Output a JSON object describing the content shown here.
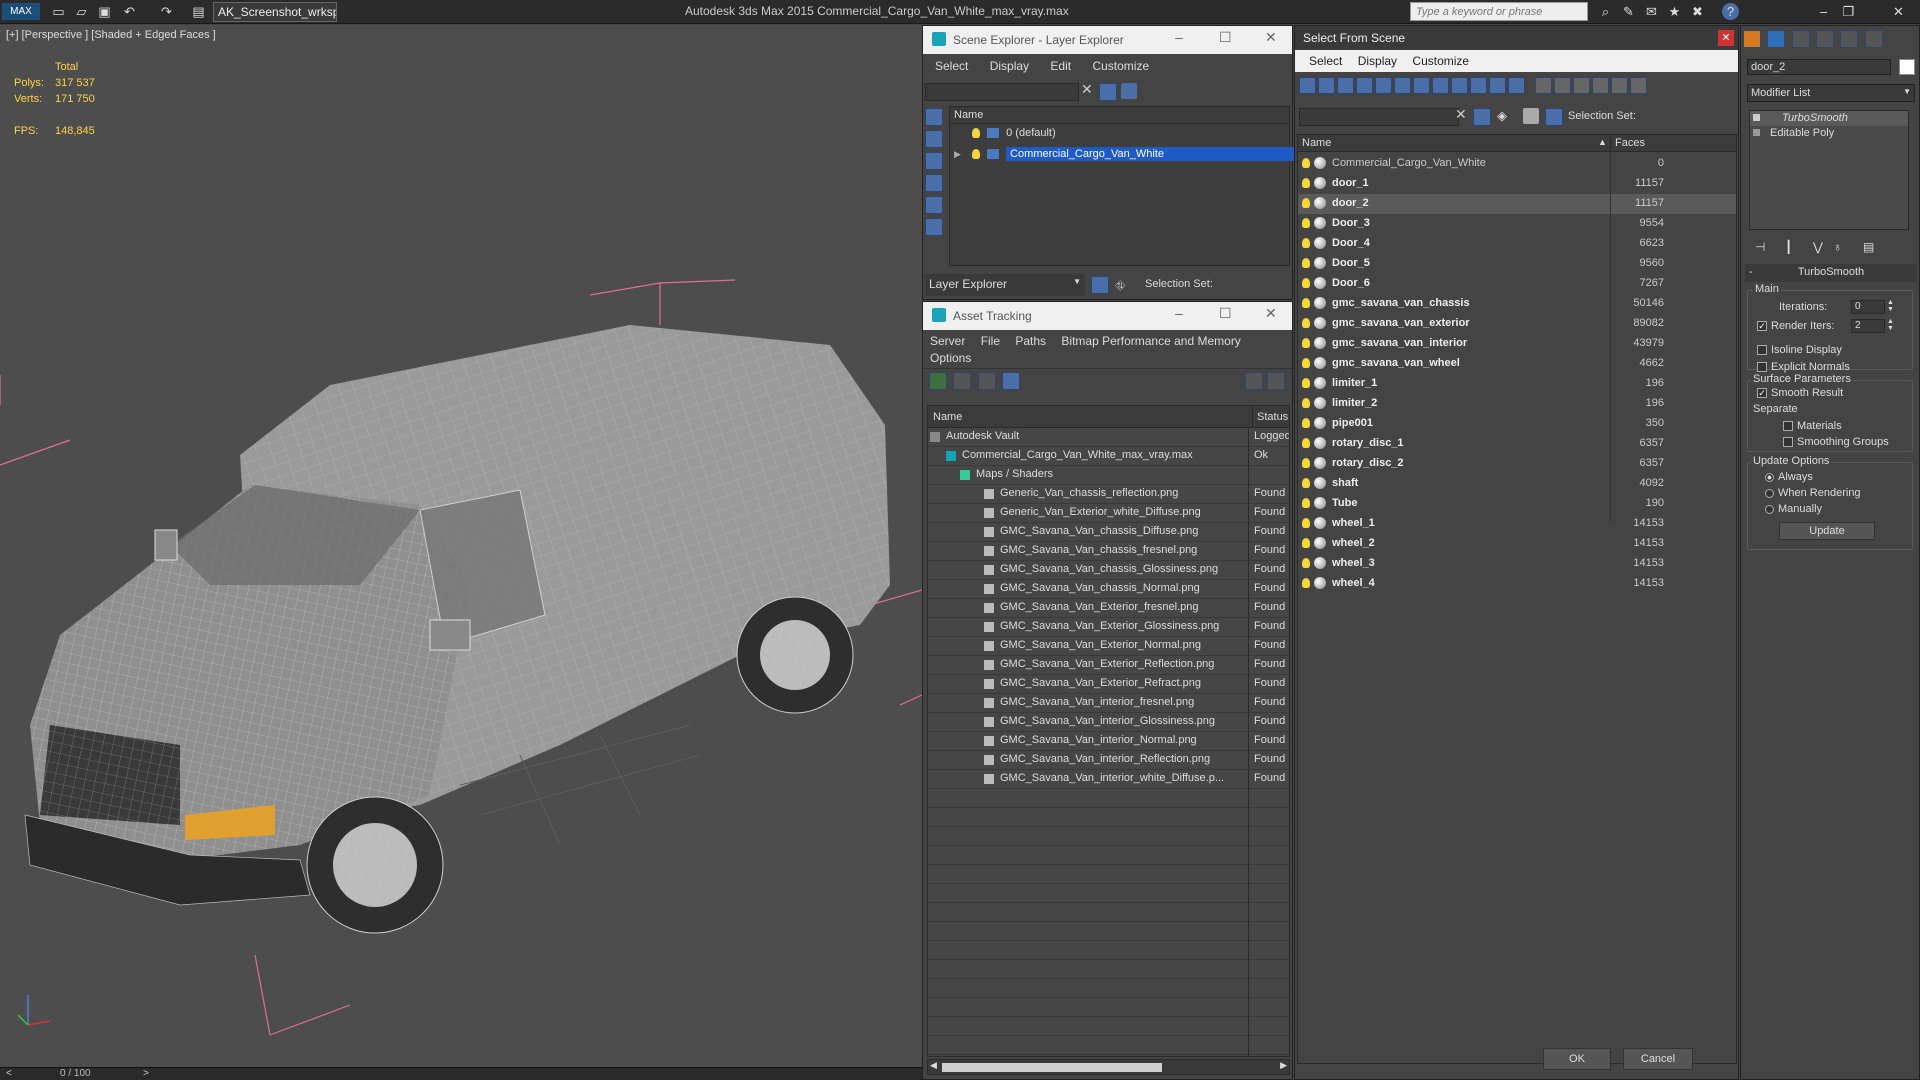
{
  "titlebar": {
    "workspace": "AK_Screenshot_wrksp",
    "app_title": "Autodesk 3ds Max  2015     Commercial_Cargo_Van_White_max_vray.max",
    "search_placeholder": "Type a keyword or phrase"
  },
  "viewport": {
    "label": "[+] [Perspective ] [Shaded + Edged Faces ]",
    "total_label": "Total",
    "polys_label": "Polys:",
    "polys_value": "317 537",
    "verts_label": "Verts:",
    "verts_value": "171 750",
    "fps_label": "FPS:",
    "fps_value": "148,845",
    "timeline": "0 / 100",
    "prev": "<",
    "next": ">"
  },
  "scene_explorer": {
    "title": "Scene Explorer - Layer Explorer",
    "menu": [
      "Select",
      "Display",
      "Edit",
      "Customize"
    ],
    "col_name": "Name",
    "layers": [
      "0 (default)",
      "Commercial_Cargo_Van_White"
    ],
    "footer_mode": "Layer Explorer",
    "footer_selset": "Selection Set:"
  },
  "asset_tracking": {
    "title": "Asset Tracking",
    "menu": [
      "Server",
      "File",
      "Paths",
      "Bitmap Performance and Memory"
    ],
    "menu2": "Options",
    "col_name": "Name",
    "col_status": "Status",
    "rows": [
      {
        "name": "Autodesk Vault",
        "status": "Logged"
      },
      {
        "name": "Commercial_Cargo_Van_White_max_vray.max",
        "status": "Ok"
      },
      {
        "name": "Maps / Shaders",
        "status": ""
      },
      {
        "name": "Generic_Van_chassis_reflection.png",
        "status": "Found"
      },
      {
        "name": "Generic_Van_Exterior_white_Diffuse.png",
        "status": "Found"
      },
      {
        "name": "GMC_Savana_Van_chassis_Diffuse.png",
        "status": "Found"
      },
      {
        "name": "GMC_Savana_Van_chassis_fresnel.png",
        "status": "Found"
      },
      {
        "name": "GMC_Savana_Van_chassis_Glossiness.png",
        "status": "Found"
      },
      {
        "name": "GMC_Savana_Van_chassis_Normal.png",
        "status": "Found"
      },
      {
        "name": "GMC_Savana_Van_Exterior_fresnel.png",
        "status": "Found"
      },
      {
        "name": "GMC_Savana_Van_Exterior_Glossiness.png",
        "status": "Found"
      },
      {
        "name": "GMC_Savana_Van_Exterior_Normal.png",
        "status": "Found"
      },
      {
        "name": "GMC_Savana_Van_Exterior_Reflection.png",
        "status": "Found"
      },
      {
        "name": "GMC_Savana_Van_Exterior_Refract.png",
        "status": "Found"
      },
      {
        "name": "GMC_Savana_Van_interior_fresnel.png",
        "status": "Found"
      },
      {
        "name": "GMC_Savana_Van_interior_Glossiness.png",
        "status": "Found"
      },
      {
        "name": "GMC_Savana_Van_interior_Normal.png",
        "status": "Found"
      },
      {
        "name": "GMC_Savana_Van_interior_Reflection.png",
        "status": "Found"
      },
      {
        "name": "GMC_Savana_Van_interior_white_Diffuse.p...",
        "status": "Found"
      }
    ]
  },
  "select_from_scene": {
    "title": "Select From Scene",
    "menu": [
      "Select",
      "Display",
      "Customize"
    ],
    "selset_label": "Selection Set:",
    "col_name": "Name",
    "col_faces": "Faces",
    "rows": [
      {
        "name": "Commercial_Cargo_Van_White",
        "faces": "0",
        "bold": false
      },
      {
        "name": "door_1",
        "faces": "11157",
        "bold": true
      },
      {
        "name": "door_2",
        "faces": "11157",
        "bold": true,
        "selected": true
      },
      {
        "name": "Door_3",
        "faces": "9554",
        "bold": true
      },
      {
        "name": "Door_4",
        "faces": "6623",
        "bold": true
      },
      {
        "name": "Door_5",
        "faces": "9560",
        "bold": true
      },
      {
        "name": "Door_6",
        "faces": "7267",
        "bold": true
      },
      {
        "name": "gmc_savana_van_chassis",
        "faces": "50146",
        "bold": true
      },
      {
        "name": "gmc_savana_van_exterior",
        "faces": "89082",
        "bold": true
      },
      {
        "name": "gmc_savana_van_interior",
        "faces": "43979",
        "bold": true
      },
      {
        "name": "gmc_savana_van_wheel",
        "faces": "4662",
        "bold": true
      },
      {
        "name": "limiter_1",
        "faces": "196",
        "bold": true
      },
      {
        "name": "limiter_2",
        "faces": "196",
        "bold": true
      },
      {
        "name": "pipe001",
        "faces": "350",
        "bold": true
      },
      {
        "name": "rotary_disc_1",
        "faces": "6357",
        "bold": true
      },
      {
        "name": "rotary_disc_2",
        "faces": "6357",
        "bold": true
      },
      {
        "name": "shaft",
        "faces": "4092",
        "bold": true
      },
      {
        "name": "Tube",
        "faces": "190",
        "bold": true
      },
      {
        "name": "wheel_1",
        "faces": "14153",
        "bold": true
      },
      {
        "name": "wheel_2",
        "faces": "14153",
        "bold": true
      },
      {
        "name": "wheel_3",
        "faces": "14153",
        "bold": true
      },
      {
        "name": "wheel_4",
        "faces": "14153",
        "bold": true
      }
    ],
    "ok": "OK",
    "cancel": "Cancel"
  },
  "modify_panel": {
    "object_name": "door_2",
    "modifier_list": "Modifier List",
    "stack": [
      "TurboSmooth",
      "Editable Poly"
    ],
    "rollout_title": "TurboSmooth",
    "main_label": "Main",
    "iterations_label": "Iterations:",
    "iterations_value": "0",
    "render_iters_label": "Render Iters:",
    "render_iters_value": "2",
    "isoline": "Isoline Display",
    "explicit_normals": "Explicit Normals",
    "surface_params": "Surface Parameters",
    "smooth_result": "Smooth Result",
    "separate": "Separate",
    "materials": "Materials",
    "smoothing_groups": "Smoothing Groups",
    "update_options": "Update Options",
    "always": "Always",
    "when_rendering": "When Rendering",
    "manually": "Manually",
    "update_btn": "Update"
  },
  "colors": {
    "accent_blue": "#4a6fa8",
    "selection": "#1e5bc6",
    "stat_yellow": "#ffd24a"
  }
}
